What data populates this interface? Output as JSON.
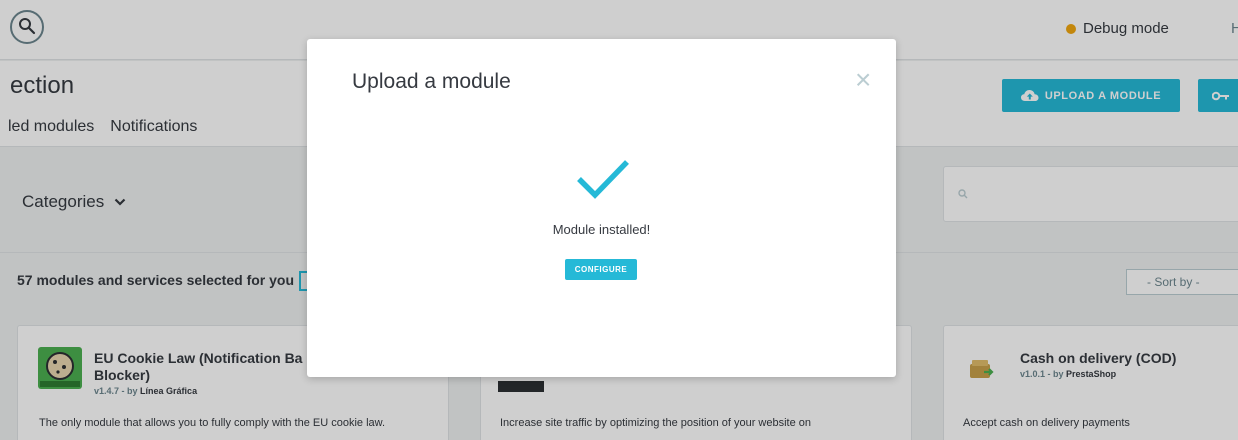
{
  "topbar": {
    "debug_label": "Debug mode",
    "partial_text": "H"
  },
  "header": {
    "title": "ection",
    "tabs": [
      "led modules",
      "Notifications"
    ],
    "upload_button": "UPLOAD A MODULE"
  },
  "filters": {
    "categories_label": "Categories",
    "search_placeholder": ""
  },
  "results": {
    "count_text": "57 modules and services selected for you",
    "sort_label": "- Sort by -"
  },
  "cards": [
    {
      "title": "EU Cookie Law (Notification Ba\nBlocker)",
      "title_line1": "EU Cookie Law (Notification Ba",
      "title_line2": "Blocker)",
      "version": "v1.4.7 - by",
      "author": "Línea Gráfica",
      "description": "The only module that allows you to fully comply with the EU cookie law."
    },
    {
      "description": "Increase site traffic by optimizing the position of your website on"
    },
    {
      "title": "Cash on delivery (COD)",
      "version": "v1.0.1 - by",
      "author": "PrestaShop",
      "description": "Accept cash on delivery payments"
    }
  ],
  "modal": {
    "title": "Upload a module",
    "message": "Module installed!",
    "configure_button": "CONFIGURE"
  },
  "colors": {
    "accent": "#25b9d7",
    "debug": "#f0a70f",
    "text": "#363a41"
  }
}
